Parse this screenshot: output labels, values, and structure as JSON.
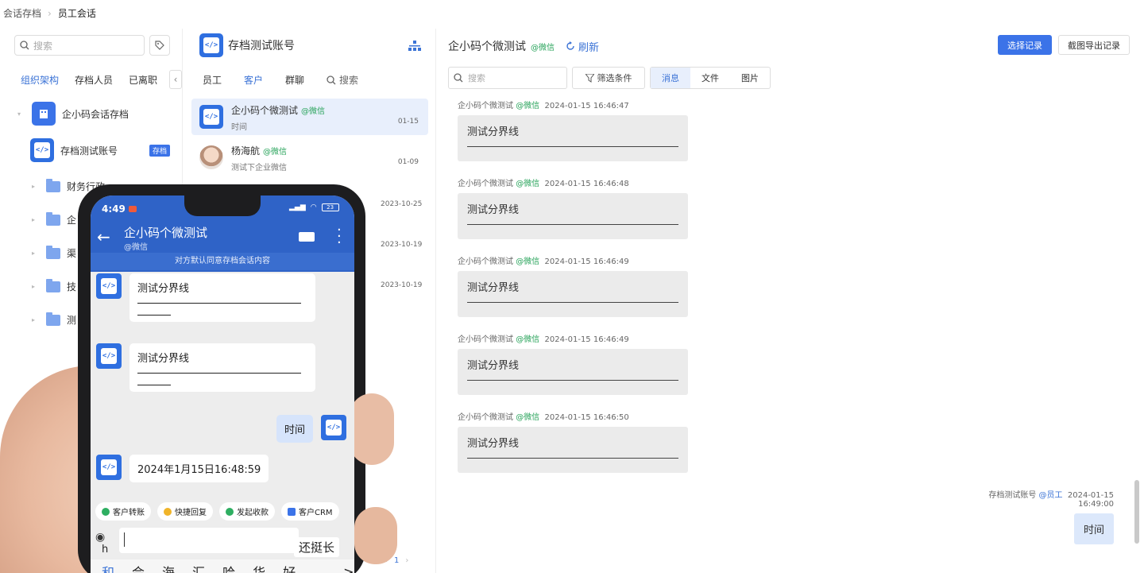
{
  "breadcrumb": {
    "root": "会话存档",
    "current": "员工会话"
  },
  "left": {
    "search_placeholder": "搜索",
    "tabs": [
      "组织架构",
      "存档人员",
      "已离职"
    ],
    "org_name": "企小码会话存档",
    "account_name": "存档测试账号",
    "account_badge": "存档",
    "folders": [
      "财务行政",
      "企",
      "渠",
      "技",
      "测"
    ]
  },
  "mid": {
    "title": "存档测试账号",
    "tabs": [
      "员工",
      "客户",
      "群聊"
    ],
    "search_label": "搜索",
    "conversations": [
      {
        "name": "企小码个微测试",
        "tag": "@微信",
        "sub": "时间",
        "date": "01-15"
      },
      {
        "name": "杨海航",
        "tag": "@微信",
        "sub": "测试下企业微信",
        "date": "01-09"
      }
    ],
    "other_dates": [
      "2023-10-25",
      "2023-10-19",
      "2023-10-19"
    ],
    "page": "1"
  },
  "right": {
    "title": "企小码个微测试",
    "title_tag": "@微信",
    "refresh": "刷新",
    "btn_select": "选择记录",
    "btn_export": "截图导出记录",
    "search_placeholder": "搜索",
    "filter": "筛选条件",
    "type_tabs": [
      "消息",
      "文件",
      "图片"
    ],
    "messages": [
      {
        "sender": "企小码个微测试",
        "tag": "@微信",
        "time": "2024-01-15 16:46:47",
        "text": "测试分界线"
      },
      {
        "sender": "企小码个微测试",
        "tag": "@微信",
        "time": "2024-01-15 16:46:48",
        "text": "测试分界线"
      },
      {
        "sender": "企小码个微测试",
        "tag": "@微信",
        "time": "2024-01-15 16:46:49",
        "text": "测试分界线"
      },
      {
        "sender": "企小码个微测试",
        "tag": "@微信",
        "time": "2024-01-15 16:46:49",
        "text": "测试分界线"
      },
      {
        "sender": "企小码个微测试",
        "tag": "@微信",
        "time": "2024-01-15 16:46:50",
        "text": "测试分界线"
      }
    ],
    "self_message": {
      "sender": "存档测试账号",
      "tag": "@员工",
      "time": "2024-01-15 16:49:00",
      "text": "时间"
    }
  },
  "phone": {
    "time": "4:49",
    "battery": "23",
    "chat_title": "企小码个微测试",
    "chat_sub": "@微信",
    "notice": "对方默认同意存档会话内容",
    "msg1": "测试分界线",
    "msg2": "测试分界线",
    "self_msg": "时间",
    "msg3": "2024年1月15日16:48:59",
    "chips": [
      "客户转账",
      "快捷回复",
      "发起收款",
      "客户CRM"
    ],
    "input_char": "h",
    "suggestion": "还挺长",
    "keyboard": [
      "和",
      "会",
      "海",
      "汇",
      "哈",
      "华",
      "好",
      "…",
      ">"
    ]
  },
  "colors": {
    "accent": "#3b73e8",
    "wechat": "#27a35a"
  }
}
